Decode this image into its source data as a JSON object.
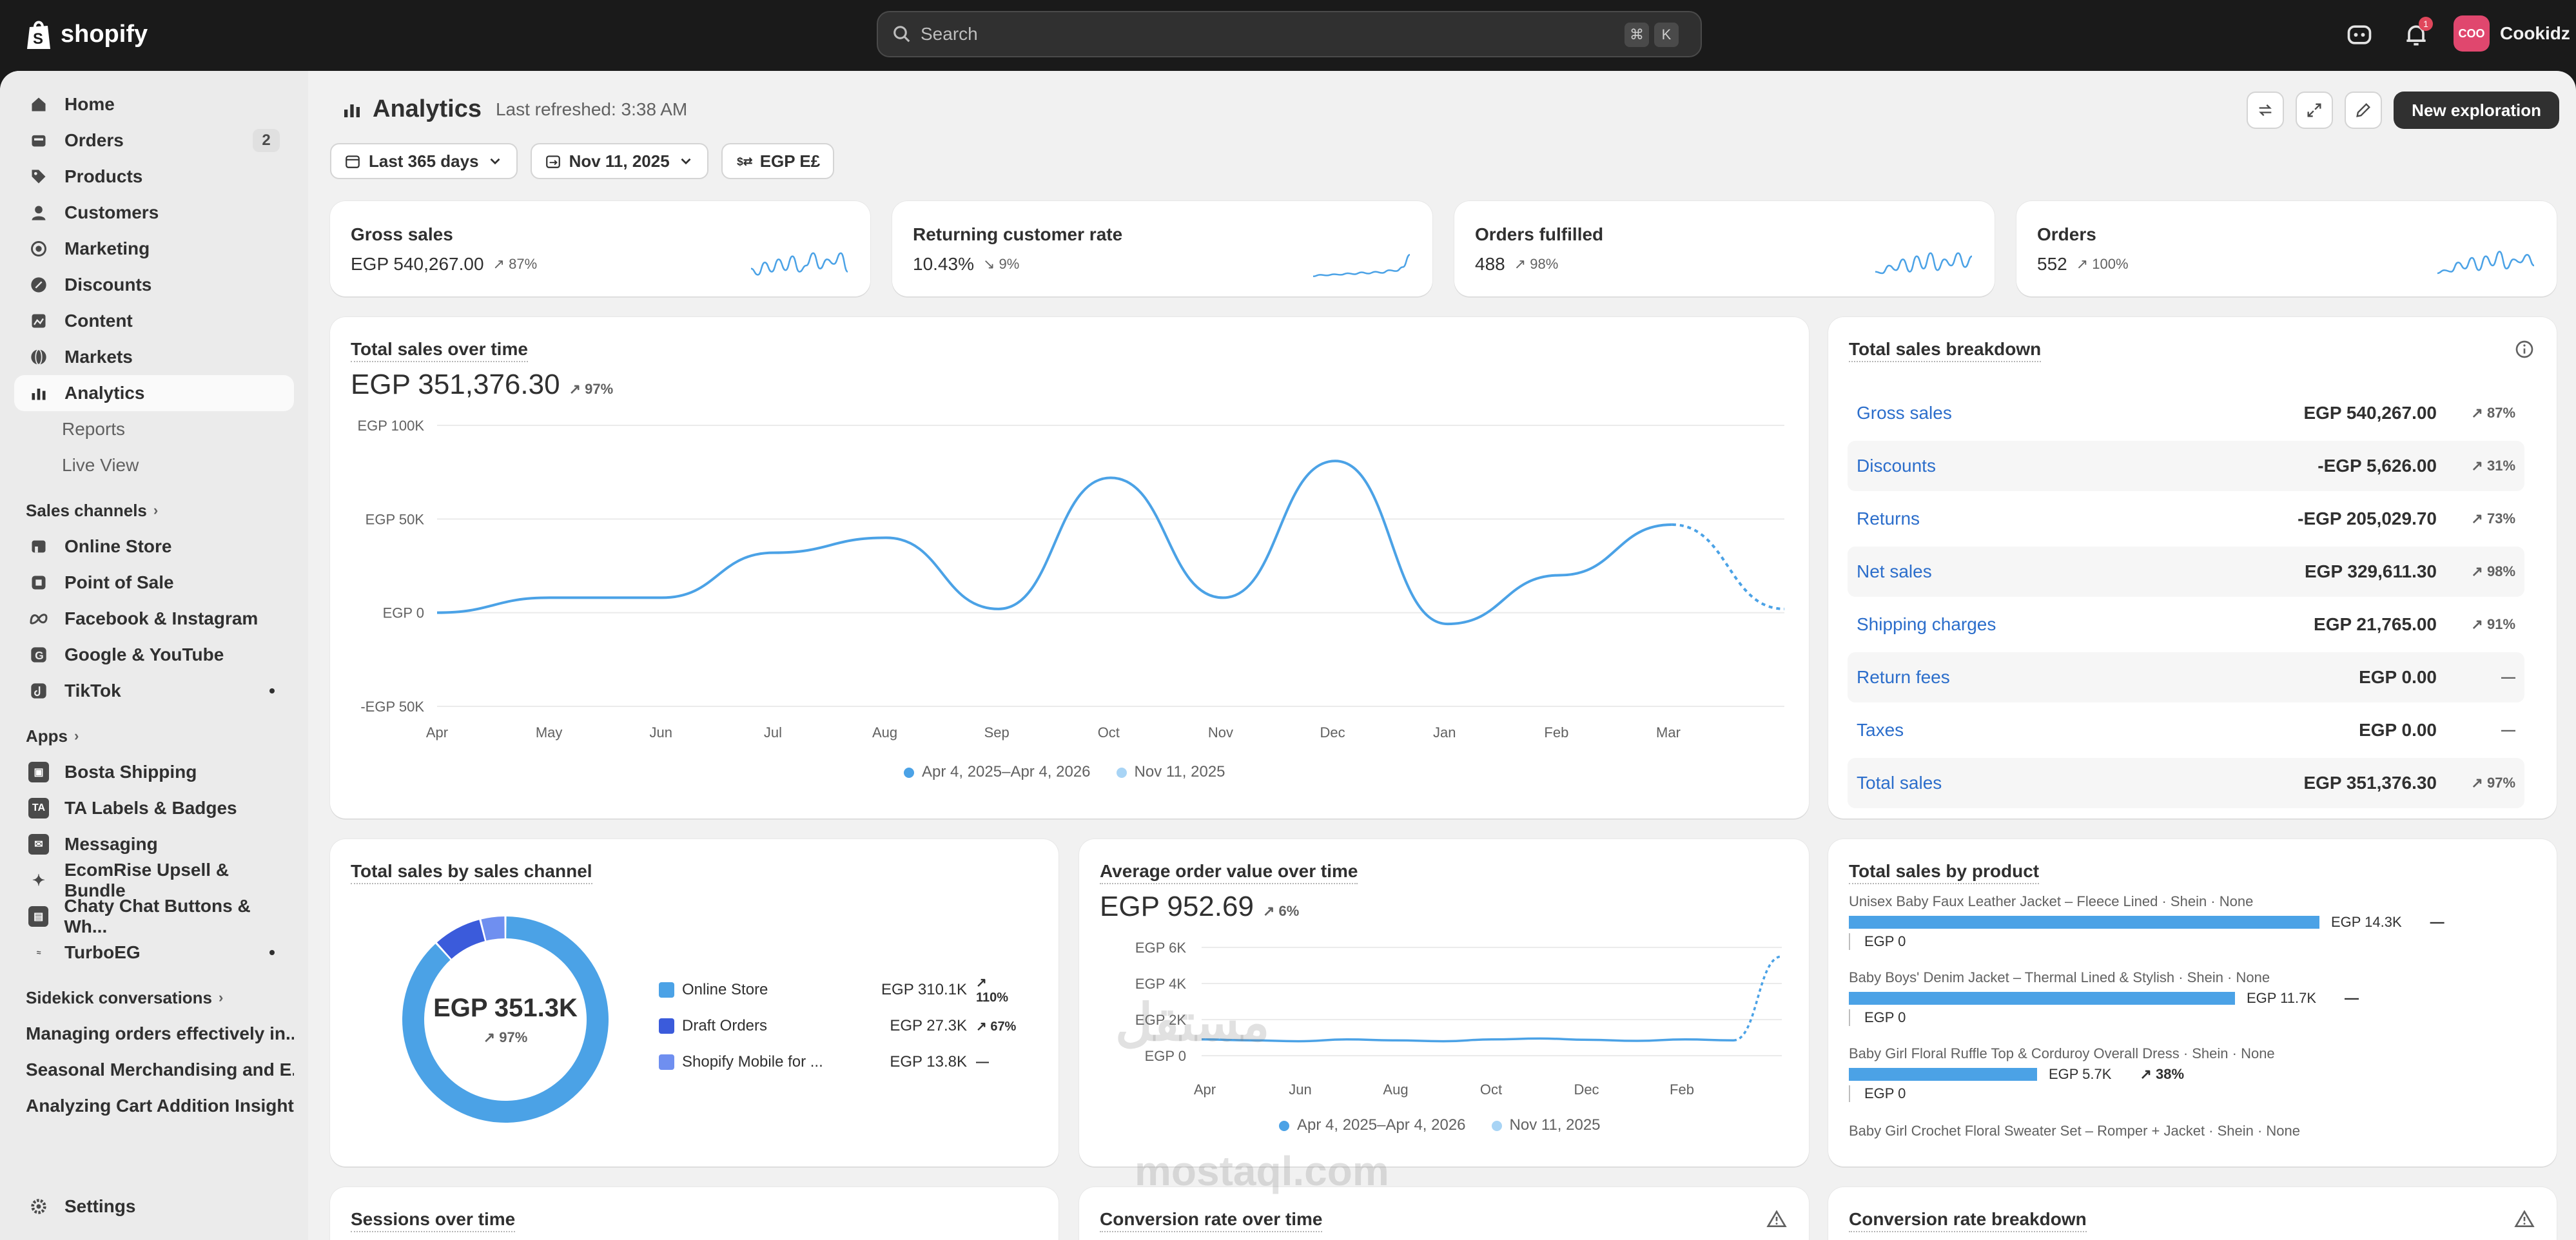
{
  "topbar": {
    "brand": "shopify",
    "search_placeholder": "Search",
    "kbd1": "⌘",
    "kbd2": "K",
    "notification_count": "1",
    "store_initials": "COO",
    "store_name": "Cookidz"
  },
  "sidebar": {
    "main": [
      {
        "label": "Home",
        "icon": "home-icon"
      },
      {
        "label": "Orders",
        "icon": "orders-icon",
        "badge": "2"
      },
      {
        "label": "Products",
        "icon": "tag-icon"
      },
      {
        "label": "Customers",
        "icon": "person-icon"
      },
      {
        "label": "Marketing",
        "icon": "target-icon"
      },
      {
        "label": "Discounts",
        "icon": "discount-icon"
      },
      {
        "label": "Content",
        "icon": "content-icon"
      },
      {
        "label": "Markets",
        "icon": "globe-icon"
      },
      {
        "label": "Analytics",
        "icon": "chart-icon"
      }
    ],
    "analytics_sub": [
      "Reports",
      "Live View"
    ],
    "sales_channels_title": "Sales channels",
    "sales_channels": [
      "Online Store",
      "Point of Sale",
      "Facebook & Instagram",
      "Google & YouTube",
      "TikTok"
    ],
    "apps_title": "Apps",
    "apps": [
      "Bosta Shipping",
      "TA Labels & Badges",
      "Messaging",
      "EcomRise Upsell & Bundle",
      "Chaty Chat Buttons & Wh...",
      "TurboEG"
    ],
    "sidekick_title": "Sidekick conversations",
    "conversations": [
      "Managing orders effectively in...",
      "Seasonal Merchandising and E...",
      "Analyzing Cart Addition Insights"
    ],
    "settings": "Settings"
  },
  "header": {
    "title": "Analytics",
    "refreshed": "Last refreshed: 3:38 AM",
    "new_exploration": "New exploration"
  },
  "filters": {
    "range": "Last 365 days",
    "compare": "Nov 11, 2025",
    "currency": "EGP E£"
  },
  "kpis": [
    {
      "title": "Gross sales",
      "value": "EGP 540,267.00",
      "change": "↗ 87%",
      "spark": [
        0.4,
        0.2,
        0.6,
        0.3,
        0.7,
        0.35,
        0.8,
        0.3,
        0.5,
        0.9,
        0.4,
        0.7,
        0.55,
        0.9,
        0.3
      ]
    },
    {
      "title": "Returning customer rate",
      "value": "10.43%",
      "change": "↘ 9%",
      "spark": [
        0.15,
        0.2,
        0.18,
        0.22,
        0.2,
        0.25,
        0.22,
        0.28,
        0.24,
        0.3,
        0.26,
        0.35,
        0.32,
        0.45,
        0.85
      ]
    },
    {
      "title": "Orders fulfilled",
      "value": "488",
      "change": "↗ 98%",
      "spark": [
        0.3,
        0.25,
        0.5,
        0.35,
        0.7,
        0.3,
        0.8,
        0.4,
        0.9,
        0.35,
        0.7,
        0.5,
        0.9,
        0.45,
        0.8
      ]
    },
    {
      "title": "Orders",
      "value": "552",
      "change": "↗ 100%",
      "spark": [
        0.25,
        0.35,
        0.3,
        0.6,
        0.4,
        0.75,
        0.35,
        0.8,
        0.5,
        0.95,
        0.4,
        0.7,
        0.6,
        0.85,
        0.5
      ]
    }
  ],
  "total_sales": {
    "title": "Total sales over time",
    "value": "EGP 351,376.30",
    "change": "↗ 97%",
    "legend_current": "Apr 4, 2025–Apr 4, 2026",
    "legend_previous": "Nov 11, 2025"
  },
  "breakdown": {
    "title": "Total sales breakdown",
    "rows": [
      {
        "label": "Gross sales",
        "value": "EGP 540,267.00",
        "change": "↗ 87%"
      },
      {
        "label": "Discounts",
        "value": "-EGP 5,626.00",
        "change": "↗ 31%"
      },
      {
        "label": "Returns",
        "value": "-EGP 205,029.70",
        "change": "↗ 73%"
      },
      {
        "label": "Net sales",
        "value": "EGP 329,611.30",
        "change": "↗ 98%"
      },
      {
        "label": "Shipping charges",
        "value": "EGP 21,765.00",
        "change": "↗ 91%"
      },
      {
        "label": "Return fees",
        "value": "EGP 0.00",
        "change": "—"
      },
      {
        "label": "Taxes",
        "value": "EGP 0.00",
        "change": "—"
      },
      {
        "label": "Total sales",
        "value": "EGP 351,376.30",
        "change": "↗ 97%"
      }
    ]
  },
  "by_channel": {
    "title": "Total sales by sales channel",
    "center_value": "EGP 351.3K",
    "center_change": "↗ 97%",
    "rows": [
      {
        "name": "Online Store",
        "amount": "EGP 310.1K",
        "change": "↗ 110%",
        "color": "#4ba2e6"
      },
      {
        "name": "Draft Orders",
        "amount": "EGP 27.3K",
        "change": "↗ 67%",
        "color": "#3b5bdb"
      },
      {
        "name": "Shopify Mobile for ...",
        "amount": "EGP 13.8K",
        "change": "—",
        "color": "#6f8ff0"
      }
    ]
  },
  "aov": {
    "title": "Average order value over time",
    "value": "EGP 952.69",
    "change": "↗ 6%",
    "legend_current": "Apr 4, 2025–Apr 4, 2026",
    "legend_previous": "Nov 11, 2025"
  },
  "by_product": {
    "title": "Total sales by product",
    "items": [
      {
        "name": "Unisex Baby Faux Leather Jacket – Fleece Lined · Shein · None",
        "value": "EGP 14.3K",
        "share": 1.0,
        "change": "—",
        "prev": "EGP 0"
      },
      {
        "name": "Baby Boys' Denim Jacket – Thermal Lined & Stylish · Shein · None",
        "value": "EGP 11.7K",
        "share": 0.82,
        "change": "—",
        "prev": "EGP 0"
      },
      {
        "name": "Baby Girl Floral Ruffle Top & Corduroy Overall Dress · Shein · None",
        "value": "EGP 5.7K",
        "share": 0.4,
        "change": "↗ 38%",
        "prev": "EGP 0"
      },
      {
        "name": "Baby Girl Crochet Floral Sweater Set – Romper + Jacket · Shein · None",
        "value": "",
        "share": 0,
        "change": "",
        "prev": ""
      }
    ]
  },
  "bottom_cards": [
    "Sessions over time",
    "Conversion rate over time",
    "Conversion rate breakdown"
  ],
  "watermark": {
    "top": "مستقل",
    "bottom": "mostaql.com"
  },
  "chart_data": [
    {
      "type": "line",
      "title": "Total sales over time",
      "x": [
        "Apr",
        "May",
        "Jun",
        "Jul",
        "Aug",
        "Sep",
        "Oct",
        "Nov",
        "Dec",
        "Jan",
        "Feb",
        "Mar"
      ],
      "y_ticks": [
        "EGP 100K",
        "EGP 50K",
        "EGP 0",
        "-EGP 50K"
      ],
      "ylim": [
        -50000,
        100000
      ],
      "series": [
        {
          "name": "Apr 4, 2025–Apr 4, 2026",
          "values": [
            0,
            8000,
            8000,
            32000,
            40000,
            2000,
            72000,
            8000,
            81000,
            -6000,
            20000,
            47000,
            2000
          ]
        }
      ]
    },
    {
      "type": "line",
      "title": "Average order value over time",
      "x": [
        "Apr",
        "Jun",
        "Aug",
        "Oct",
        "Dec",
        "Feb"
      ],
      "y_ticks": [
        "EGP 6K",
        "EGP 4K",
        "EGP 2K",
        "EGP 0"
      ],
      "ylim": [
        0,
        6000
      ],
      "series": [
        {
          "name": "Apr 4, 2025–Apr 4, 2026",
          "values": [
            900,
            850,
            800,
            900,
            850,
            800,
            900,
            950,
            880,
            820,
            900,
            850,
            5500
          ]
        }
      ]
    },
    {
      "type": "pie",
      "title": "Total sales by sales channel",
      "categories": [
        "Online Store",
        "Draft Orders",
        "Shopify Mobile for ..."
      ],
      "values": [
        310.1,
        27.3,
        13.8
      ]
    }
  ]
}
